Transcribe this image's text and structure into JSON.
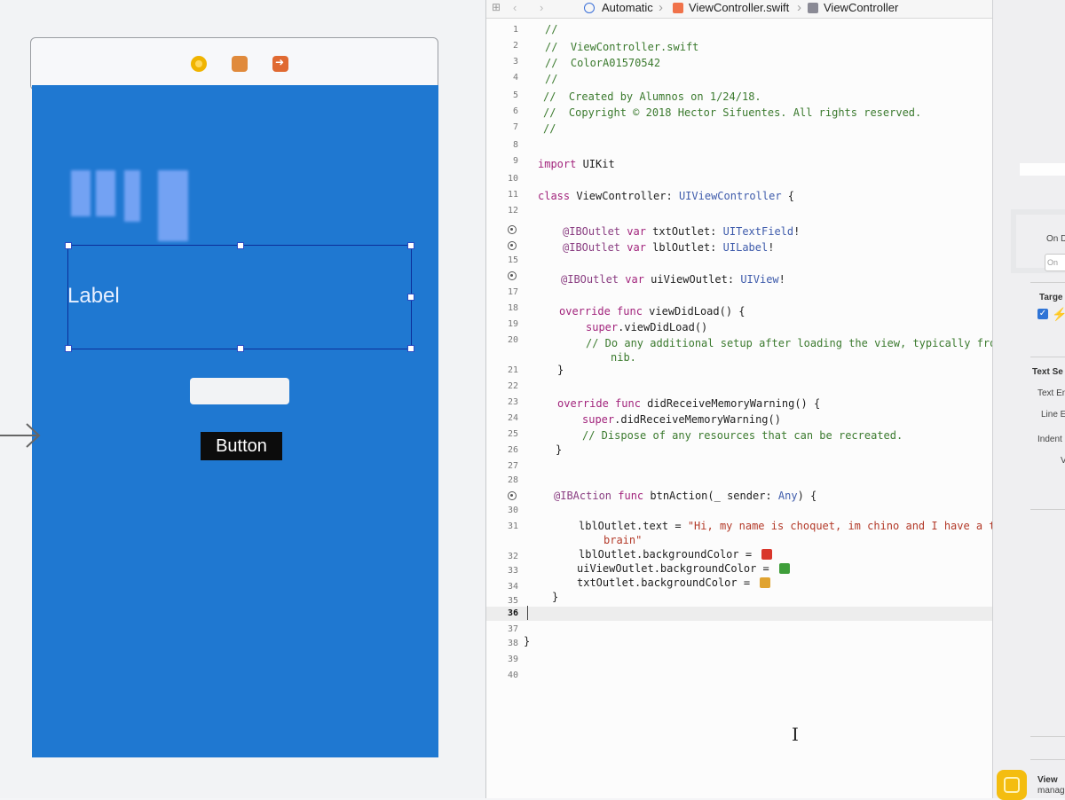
{
  "jumpbar": {
    "mode": "Automatic",
    "file": "ViewController.swift",
    "symbol": "ViewController"
  },
  "header_actions": {
    "add": "+",
    "close": "✕"
  },
  "storyboard": {
    "label_text": "Label",
    "button_text": "Button",
    "view_color": "#1f78d1"
  },
  "editor": {
    "line_numbers": [
      "1",
      "2",
      "3",
      "4",
      "5",
      "6",
      "7",
      "8",
      "9",
      "10",
      "11",
      "12",
      "15",
      "17",
      "18",
      "19",
      "20",
      "21",
      "22",
      "23",
      "24",
      "25",
      "26",
      "27",
      "28",
      "30",
      "31",
      "32",
      "33",
      "34",
      "35",
      "36",
      "37",
      "38",
      "39",
      "40"
    ],
    "current_line": "36",
    "lines": {
      "l1": "//",
      "l2": "//  ViewController.swift",
      "l3": "//  ColorA01570542",
      "l4": "//",
      "l5": "//  Created by Alumnos on 1/24/18.",
      "l6": "//  Copyright © 2018 Hector Sifuentes. All rights reserved.",
      "l7": "//",
      "l9_kw": "import",
      "l9_rest": " UIKit",
      "l11_kw": "class",
      "l11_name": " ViewController: ",
      "l11_type": "UIViewController",
      "l11_end": " {",
      "l13_attr": "@IBOutlet",
      "l13_kw": " var",
      "l13_name": " txtOutlet: ",
      "l13_type": "UITextField",
      "l13_end": "!",
      "l14_attr": "@IBOutlet",
      "l14_kw": " var",
      "l14_name": " lblOutlet: ",
      "l14_type": "UILabel",
      "l14_end": "!",
      "l16_attr": "@IBOutlet",
      "l16_kw": " var",
      "l16_name": " uiViewOutlet: ",
      "l16_type": "UIView",
      "l16_end": "!",
      "l18_kw": "override func",
      "l18_rest": " viewDidLoad() {",
      "l19_kw": "super",
      "l19_rest": ".viewDidLoad()",
      "l20": "// Do any additional setup after loading the view, typically from a",
      "l20b": "nib.",
      "l21": "}",
      "l23_kw": "override func",
      "l23_rest": " didReceiveMemoryWarning() {",
      "l24_kw": "super",
      "l24_rest": ".didReceiveMemoryWarning()",
      "l25": "// Dispose of any resources that can be recreated.",
      "l26": "}",
      "l29_attr": "@IBAction",
      "l29_kw": " func",
      "l29_name": " btnAction(_ sender: ",
      "l29_type": "Any",
      "l29_end": ") {",
      "l31_pre": "lblOutlet.text = ",
      "l31_str": "\"Hi, my name is choquet, im chino and I have a tiny",
      "l31b_str": "brain\"",
      "l32": "lblOutlet.backgroundColor = ",
      "l33": "uiViewOutlet.backgroundColor = ",
      "l34": "txtOutlet.backgroundColor = ",
      "l35": "}",
      "l38": "}"
    },
    "swatches": {
      "red": "#d9362b",
      "green": "#3f9e3a",
      "orange": "#e0a330"
    }
  },
  "inspector": {
    "on_label": "On D",
    "on_field": "On",
    "target_label": "Targe",
    "text_section": "Text Se",
    "text_enabled": "Text En",
    "line_break": "Line E",
    "indent": "Indent",
    "v_label": "V",
    "view_title": "View",
    "view_sub": "manag"
  }
}
